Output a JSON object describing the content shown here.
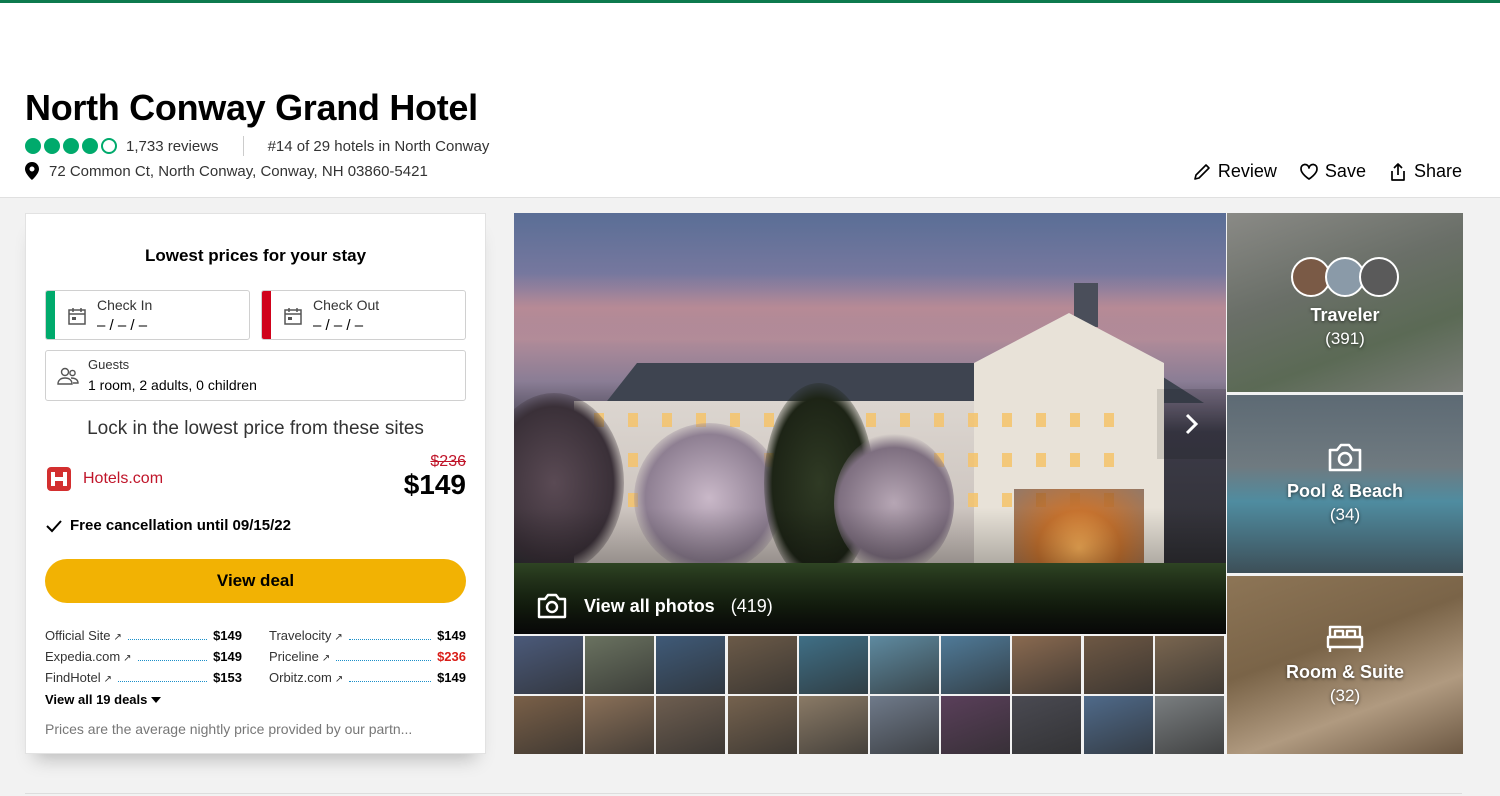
{
  "header": {
    "title": "North Conway Grand Hotel",
    "rating": 4,
    "rating_max": 5,
    "reviews": "1,733 reviews",
    "ranking": "#14 of 29 hotels in North Conway",
    "address": "72 Common Ct, North Conway, Conway, NH 03860-5421",
    "actions": {
      "review": "Review",
      "save": "Save",
      "share": "Share"
    }
  },
  "booking": {
    "title": "Lowest prices for your stay",
    "check_in": {
      "label": "Check In",
      "value": "– / – / –"
    },
    "check_out": {
      "label": "Check Out",
      "value": "– / – / –"
    },
    "guests": {
      "label": "Guests",
      "value": "1 room, 2 adults, 0 children"
    },
    "lock_text": "Lock in the lowest price from these sites",
    "provider": "Hotels.com",
    "old_price": "$236",
    "price": "$149",
    "free_cancellation": "Free cancellation until 09/15/22",
    "view_deal": "View deal",
    "deals": [
      {
        "name": "Official Site",
        "price": "$149",
        "highlight": false
      },
      {
        "name": "Travelocity",
        "price": "$149",
        "highlight": false
      },
      {
        "name": "Expedia.com",
        "price": "$149",
        "highlight": false
      },
      {
        "name": "Priceline",
        "price": "$236",
        "highlight": true
      },
      {
        "name": "FindHotel",
        "price": "$153",
        "highlight": false
      },
      {
        "name": "Orbitz.com",
        "price": "$149",
        "highlight": false
      }
    ],
    "view_all_deals": "View all 19 deals",
    "disclaimer": "Prices are the average nightly price provided by our partn..."
  },
  "gallery": {
    "view_all_label": "View all photos",
    "view_all_count": "(419)",
    "categories": [
      {
        "title": "Traveler",
        "count": "(391)"
      },
      {
        "title": "Pool & Beach",
        "count": "(34)"
      },
      {
        "title": "Room & Suite",
        "count": "(32)"
      }
    ],
    "thumbnail_colors": [
      "#4b5a7a",
      "#6a7260",
      "#3f5a78",
      "#6b5a48",
      "#3f6f86",
      "#5e8aa0",
      "#4f7a98",
      "#8a6a50",
      "#6e5844",
      "#7a6650",
      "#7a6048",
      "#8a7058",
      "#6e5e50",
      "#75624e",
      "#8a7a66",
      "#6f7a8a",
      "#5a3f5a",
      "#4a4a52",
      "#4f6a8a",
      "#7a7e80"
    ]
  },
  "colors": {
    "brand_green": "#00aa6c",
    "deal_yellow": "#f2b203",
    "checkin_bar": "#00aa6c",
    "checkout_bar": "#d0021b",
    "price_red": "#d91e18"
  }
}
